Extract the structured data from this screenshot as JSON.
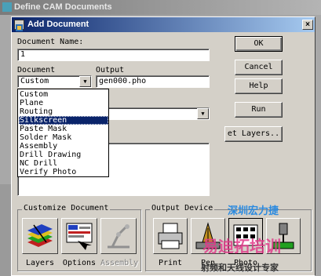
{
  "background_window": {
    "title": "Define CAM Documents"
  },
  "dialog": {
    "title": "Add Document",
    "close_glyph": "×",
    "document_name_label": "Document Name:",
    "document_name_value": "1",
    "document_label": "Document",
    "document_value": "Custom",
    "output_label": "Output",
    "output_value": "gen000.pho",
    "document_options": [
      "Custom",
      "Plane",
      "Routing",
      "Silkscreen",
      "Paste Mask",
      "Solder Mask",
      "Assembly",
      "Drill Drawing",
      "NC Drill",
      "Verify Photo"
    ],
    "selected_option": "Silkscreen",
    "buttons": {
      "ok": "OK",
      "cancel": "Cancel",
      "help": "Help",
      "run": "Run",
      "layers": "et Layers.."
    },
    "customize_group": {
      "title": "Customize Document",
      "tools": [
        {
          "label": "Layers",
          "icon": "layers-icon",
          "enabled": true
        },
        {
          "label": "Options",
          "icon": "options-icon",
          "enabled": true
        },
        {
          "label": "Assembly",
          "icon": "assembly-icon",
          "enabled": false
        }
      ]
    },
    "output_group": {
      "title": "Output Device",
      "tools": [
        {
          "label": "Print",
          "icon": "printer-icon"
        },
        {
          "label": "Pen",
          "icon": "pen-plotter-icon"
        },
        {
          "label": "Photo",
          "icon": "photo-plotter-icon"
        },
        {
          "label": "",
          "icon": "drill-icon"
        }
      ]
    }
  },
  "watermarks": {
    "top": "深圳宏力捷",
    "big": "易迪拓培训",
    "bottom": "射频和天线设计专家"
  },
  "colors": {
    "title_bar": "#0a246a",
    "selection": "#0a246a",
    "dialog_face": "#d4d0c8"
  }
}
